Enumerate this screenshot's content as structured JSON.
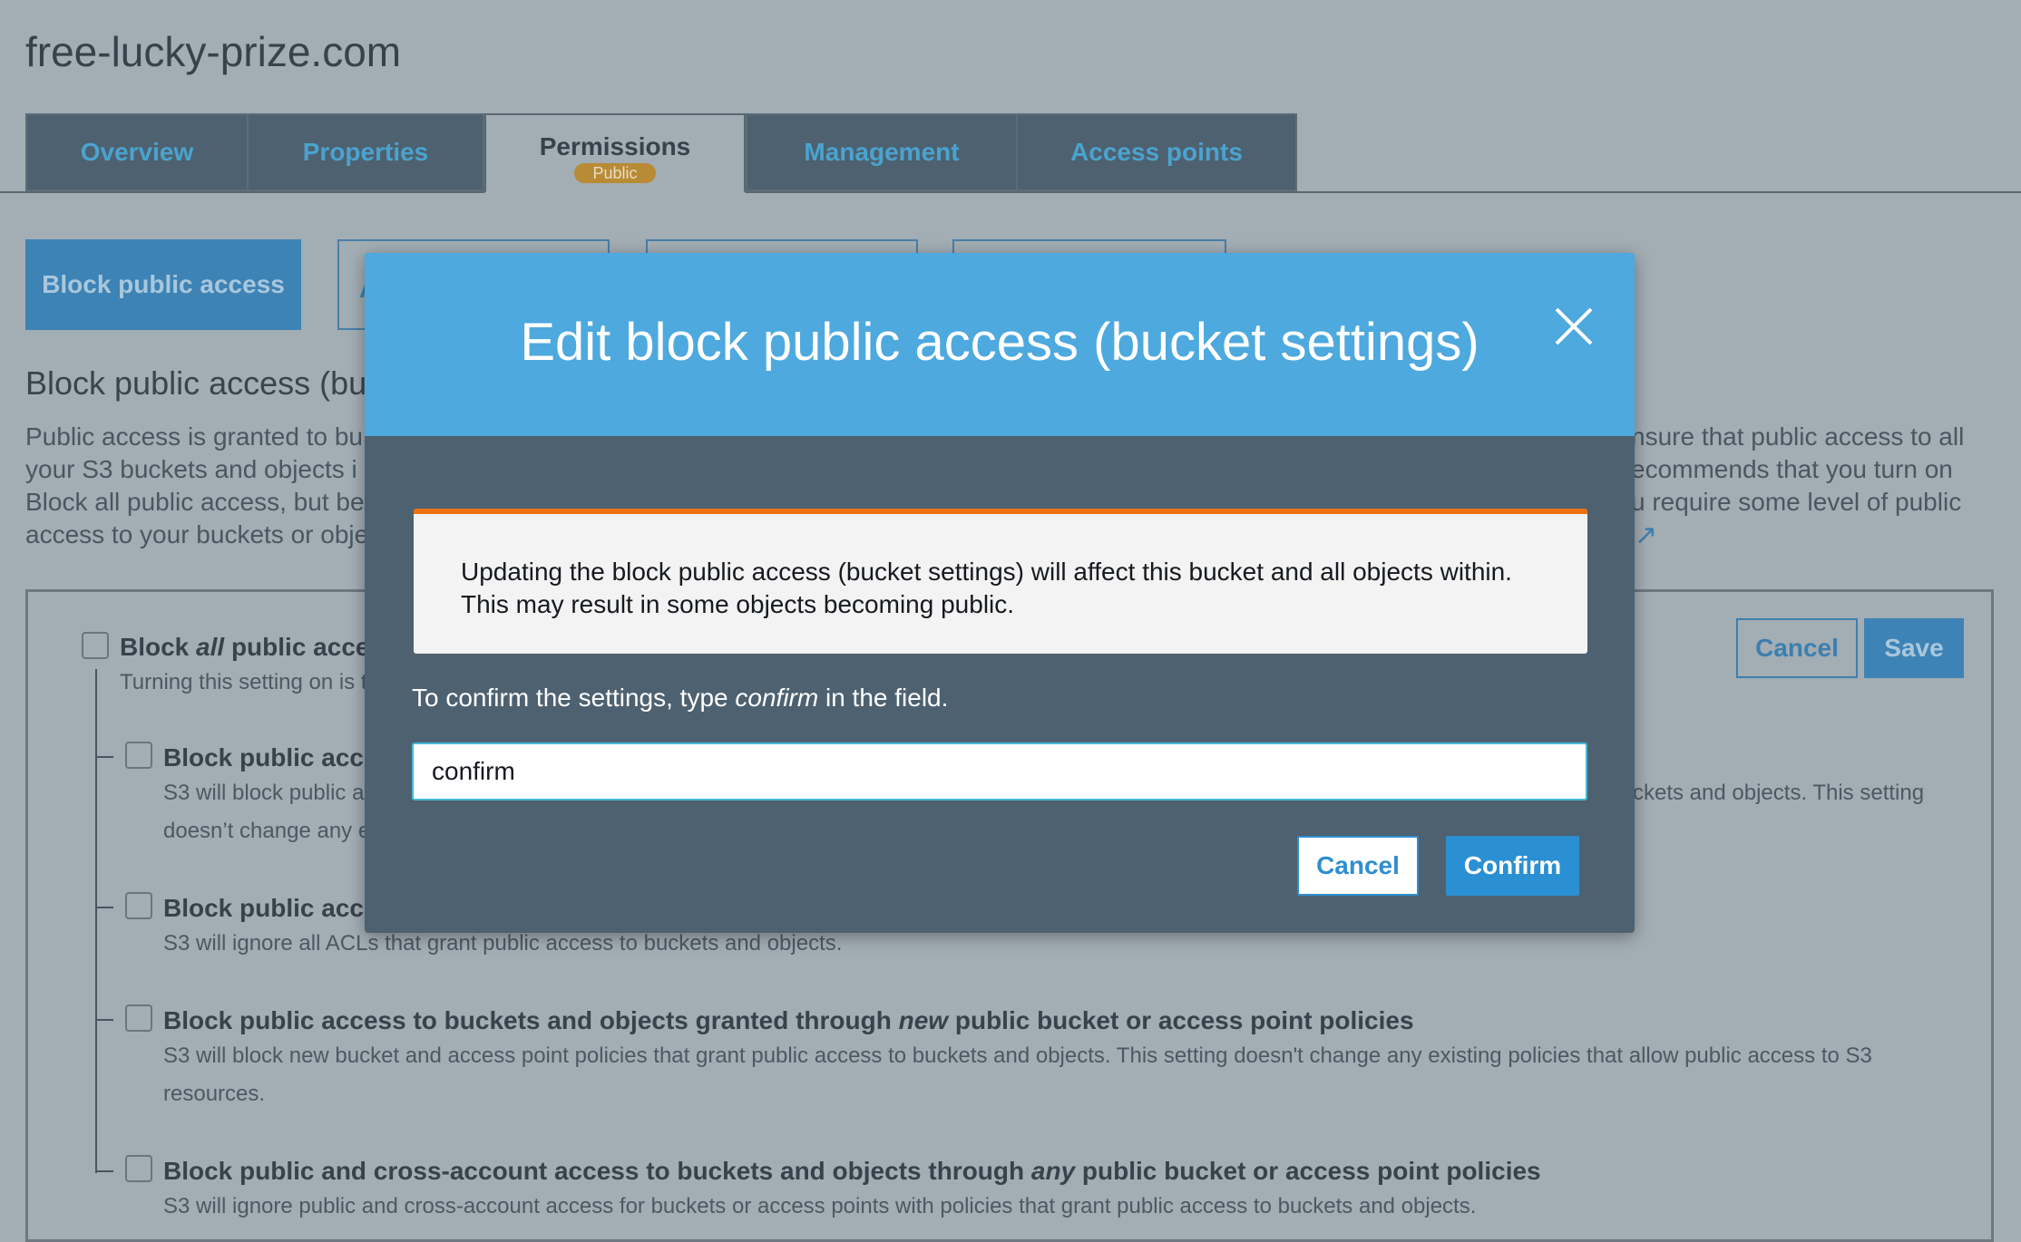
{
  "bucket": {
    "name": "free-lucky-prize.com"
  },
  "tabs": [
    {
      "label": "Overview"
    },
    {
      "label": "Properties"
    },
    {
      "label": "Permissions",
      "badge": "Public"
    },
    {
      "label": "Management"
    },
    {
      "label": "Access points"
    }
  ],
  "subtabs": {
    "active_label": "Block public access",
    "partial_label": "A"
  },
  "section": {
    "heading": "Block public access (bu",
    "para_left": [
      "Public access is granted to bu",
      "your S3 buckets and objects i",
      "Block all public access, but be",
      "access to your buckets or obje"
    ],
    "para_right": [
      "nsure that public access to all",
      "ecommends that you turn on",
      "u require some level of public"
    ]
  },
  "panel": {
    "cancel_label": "Cancel",
    "save_label": "Save",
    "block_all": {
      "pre": "Block ",
      "em": "all",
      "post": " public acce",
      "desc": "Turning this setting on is t"
    },
    "options": [
      {
        "title": "Block public acc",
        "desc_left1": "S3 will block public a",
        "desc_right1": "ckets and objects. This setting",
        "desc_left2": "doesn’t change any e"
      },
      {
        "title": "Block public acc",
        "desc": "S3 will ignore all ACLs that grant public access to buckets and objects."
      },
      {
        "title_pre": "Block public access to buckets and objects granted through ",
        "title_em": "new",
        "title_post": " public bucket or access point policies",
        "desc1": "S3 will block new bucket and access point policies that grant public access to buckets and objects. This setting doesn't change any existing policies that allow public access to S3",
        "desc2": "resources."
      },
      {
        "title_pre": "Block public and cross-account access to buckets and objects through ",
        "title_em": "any",
        "title_post": " public bucket or access point policies",
        "desc": "S3 will ignore public and cross-account access for buckets or access points with policies that grant public access to buckets and objects."
      }
    ]
  },
  "modal": {
    "title": "Edit block public access (bucket settings)",
    "alert_line1": "Updating the block public access (bucket settings) will affect this bucket and all objects within.",
    "alert_line2": "This may result in some objects becoming public.",
    "label_pre": "To confirm the settings, type ",
    "label_em": "confirm",
    "label_post": " in the field.",
    "input_value": "confirm",
    "cancel_label": "Cancel",
    "confirm_label": "Confirm"
  },
  "colors": {
    "accent": "#4da9de",
    "warning": "#ec7211",
    "primary_button": "#2b8fd3"
  }
}
